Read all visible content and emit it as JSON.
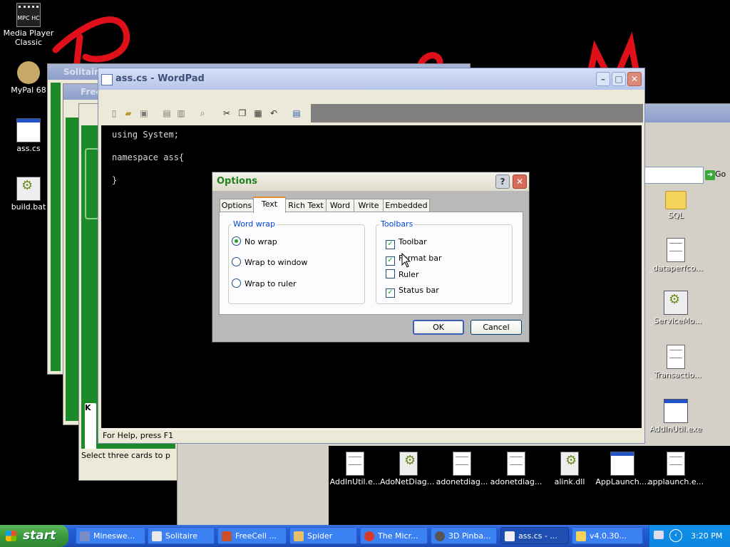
{
  "desktop": {
    "icons_left": [
      {
        "label": "Media Player Classic",
        "icon": "media-player-icon"
      },
      {
        "label": "MyPal 68",
        "icon": "mypal-browser-icon"
      },
      {
        "label": "ass.cs",
        "icon": "cs-file-icon"
      },
      {
        "label": "build.bat",
        "icon": "bat-file-icon"
      }
    ],
    "icons_right": [
      {
        "label": "SQL",
        "icon": "folder-icon"
      },
      {
        "label": "_dataperfco...",
        "icon": "text-file-icon"
      },
      {
        "label": "_ServiceMo...",
        "icon": "config-file-icon"
      },
      {
        "label": "_Transactio...",
        "icon": "text-file-icon"
      },
      {
        "label": "AddInUtil.exe",
        "icon": "exe-file-icon"
      }
    ],
    "icons_bottom": [
      {
        "label": "AddInUtil.e...",
        "icon": "file-icon"
      },
      {
        "label": "AdoNetDiag.dll",
        "icon": "dll-file-icon"
      },
      {
        "label": "adonetdiag...",
        "icon": "file-icon"
      },
      {
        "label": "adonetdiag...",
        "icon": "file-icon"
      },
      {
        "label": "alink.dll",
        "icon": "dll-file-icon"
      },
      {
        "label": "AppLaunch....",
        "icon": "exe-file-icon"
      },
      {
        "label": "applaunch.e...",
        "icon": "file-icon"
      }
    ]
  },
  "background_windows": {
    "solitaire_title": "Solitaire",
    "freecell_title": "Free",
    "spider_status": "Select three cards to p",
    "card_label": "K",
    "explorer_go": "Go"
  },
  "wordpad": {
    "title": "ass.cs - WordPad",
    "lines": [
      "using System;",
      "namespace ass{",
      "}"
    ],
    "status": "For Help, press F1"
  },
  "options_dialog": {
    "title": "Options",
    "tabs": [
      "Options",
      "Text",
      "Rich Text",
      "Word",
      "Write",
      "Embedded"
    ],
    "active_tab": "Text",
    "word_wrap": {
      "legend": "Word wrap",
      "options": [
        "No wrap",
        "Wrap to window",
        "Wrap to ruler"
      ],
      "selected": "No wrap"
    },
    "toolbars": {
      "legend": "Toolbars",
      "items": [
        {
          "label": "Toolbar",
          "checked": true
        },
        {
          "label": "Format bar",
          "checked": true
        },
        {
          "label": "Ruler",
          "checked": false
        },
        {
          "label": "Status bar",
          "checked": true
        }
      ]
    },
    "ok_label": "OK",
    "cancel_label": "Cancel"
  },
  "taskbar": {
    "start_label": "start",
    "tasks": [
      {
        "label": "Mineswe...",
        "active": false
      },
      {
        "label": "Solitaire",
        "active": false
      },
      {
        "label": "FreeCell ...",
        "active": false
      },
      {
        "label": "Spider",
        "active": false
      },
      {
        "label": "The Micr...",
        "active": false
      },
      {
        "label": "3D Pinba...",
        "active": false
      },
      {
        "label": "ass.cs - ...",
        "active": true
      },
      {
        "label": "v4.0.30...",
        "active": false
      }
    ],
    "clock": "3:20 PM"
  },
  "colors": {
    "desktop": "#000000",
    "xp_taskbar": "#245edb",
    "start_green": "#3c9a3c",
    "dialog_title_green": "#25801f",
    "scribble_red": "#e0101a"
  }
}
